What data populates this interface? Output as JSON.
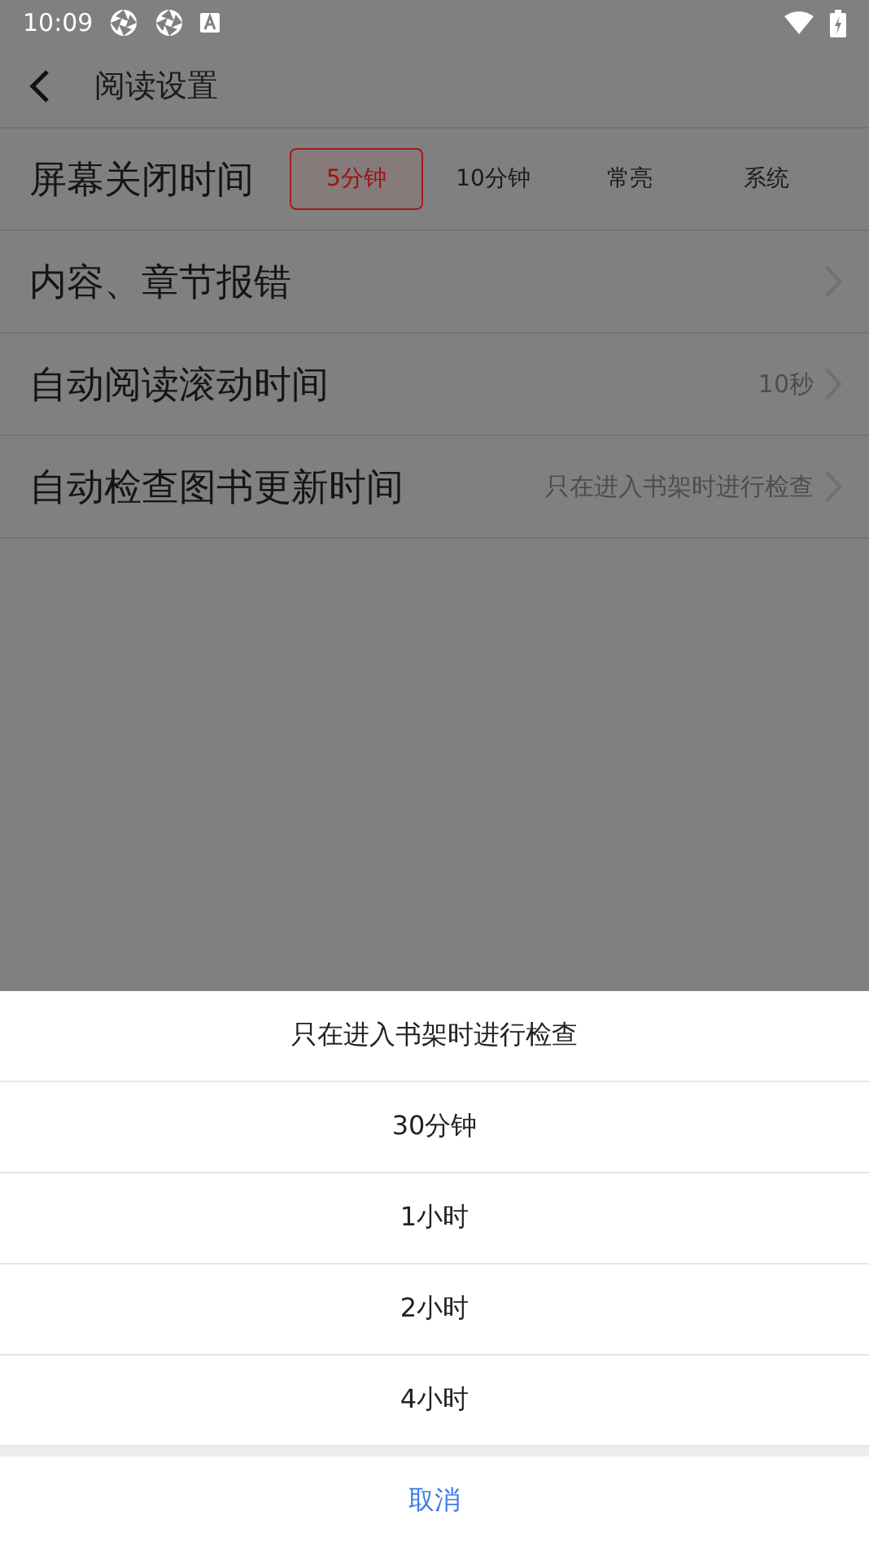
{
  "status_bar": {
    "time": "10:09"
  },
  "header": {
    "title": "阅读设置"
  },
  "settings": [
    {
      "kind": "options",
      "label": "屏幕关闭时间",
      "options": [
        {
          "label": "5分钟",
          "selected": true
        },
        {
          "label": "10分钟",
          "selected": false
        },
        {
          "label": "常亮",
          "selected": false
        },
        {
          "label": "系统",
          "selected": false
        }
      ]
    },
    {
      "kind": "link",
      "label": "内容、章节报错"
    },
    {
      "kind": "link",
      "label": "自动阅读滚动时间",
      "value": "10秒"
    },
    {
      "kind": "link",
      "label": "自动检查图书更新时间",
      "value": "只在进入书架时进行检查"
    }
  ],
  "sheet": {
    "options": [
      "只在进入书架时进行检查",
      "30分钟",
      "1小时",
      "2小时",
      "4小时"
    ],
    "cancel": "取消"
  }
}
